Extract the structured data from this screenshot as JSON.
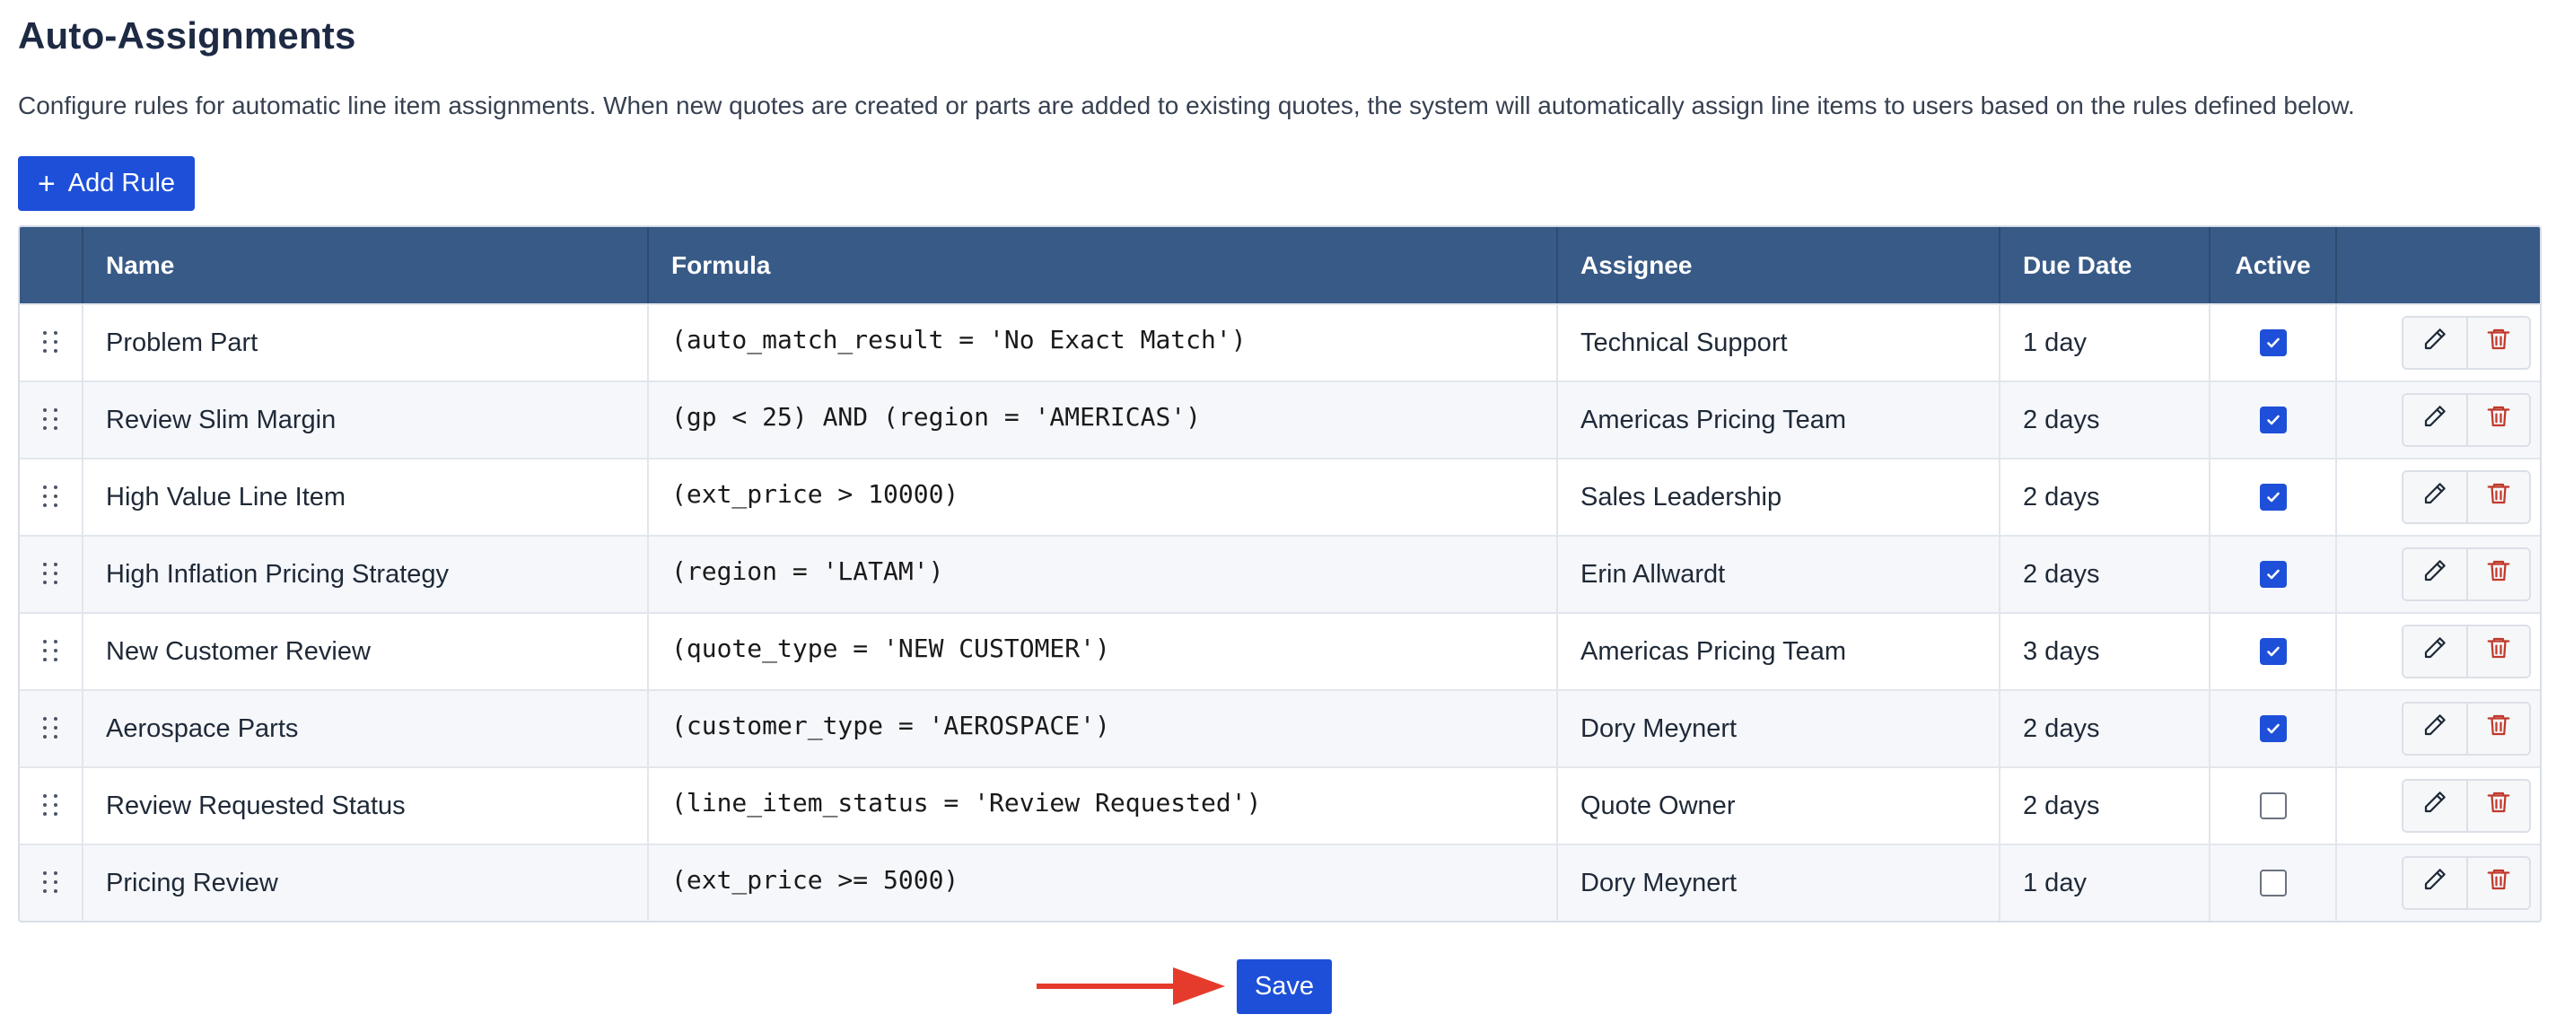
{
  "page": {
    "title": "Auto-Assignments",
    "description": "Configure rules for automatic line item assignments. When new quotes are created or parts are added to existing quotes, the system will automatically assign line items to users based on the rules defined below."
  },
  "toolbar": {
    "add_rule_label": "Add Rule",
    "add_icon": "plus-icon"
  },
  "table": {
    "columns": {
      "name": "Name",
      "formula": "Formula",
      "assignee": "Assignee",
      "due_date": "Due Date",
      "active": "Active"
    },
    "rows": [
      {
        "name": "Problem Part",
        "formula": "(auto_match_result = 'No Exact Match')",
        "assignee": "Technical Support",
        "due": "1 day",
        "active": true
      },
      {
        "name": "Review Slim Margin",
        "formula": "(gp < 25) AND (region = 'AMERICAS')",
        "assignee": "Americas Pricing Team",
        "due": "2 days",
        "active": true
      },
      {
        "name": "High Value Line Item",
        "formula": "(ext_price > 10000)",
        "assignee": "Sales Leadership",
        "due": "2 days",
        "active": true
      },
      {
        "name": "High Inflation Pricing Strategy",
        "formula": "(region = 'LATAM')",
        "assignee": "Erin Allwardt",
        "due": "2 days",
        "active": true
      },
      {
        "name": "New Customer Review",
        "formula": "(quote_type = 'NEW CUSTOMER')",
        "assignee": "Americas Pricing Team",
        "due": "3 days",
        "active": true
      },
      {
        "name": "Aerospace Parts",
        "formula": "(customer_type = 'AEROSPACE')",
        "assignee": "Dory Meynert",
        "due": "2 days",
        "active": true
      },
      {
        "name": "Review Requested Status",
        "formula": "(line_item_status = 'Review Requested')",
        "assignee": "Quote Owner",
        "due": "2 days",
        "active": false
      },
      {
        "name": "Pricing Review",
        "formula": "(ext_price >= 5000)",
        "assignee": "Dory Meynert",
        "due": "1 day",
        "active": false
      }
    ]
  },
  "footer": {
    "save_label": "Save"
  },
  "colors": {
    "header_bg": "#385a87",
    "primary": "#1d4fd8",
    "delete": "#c0392b",
    "arrow": "#e53b2c"
  }
}
